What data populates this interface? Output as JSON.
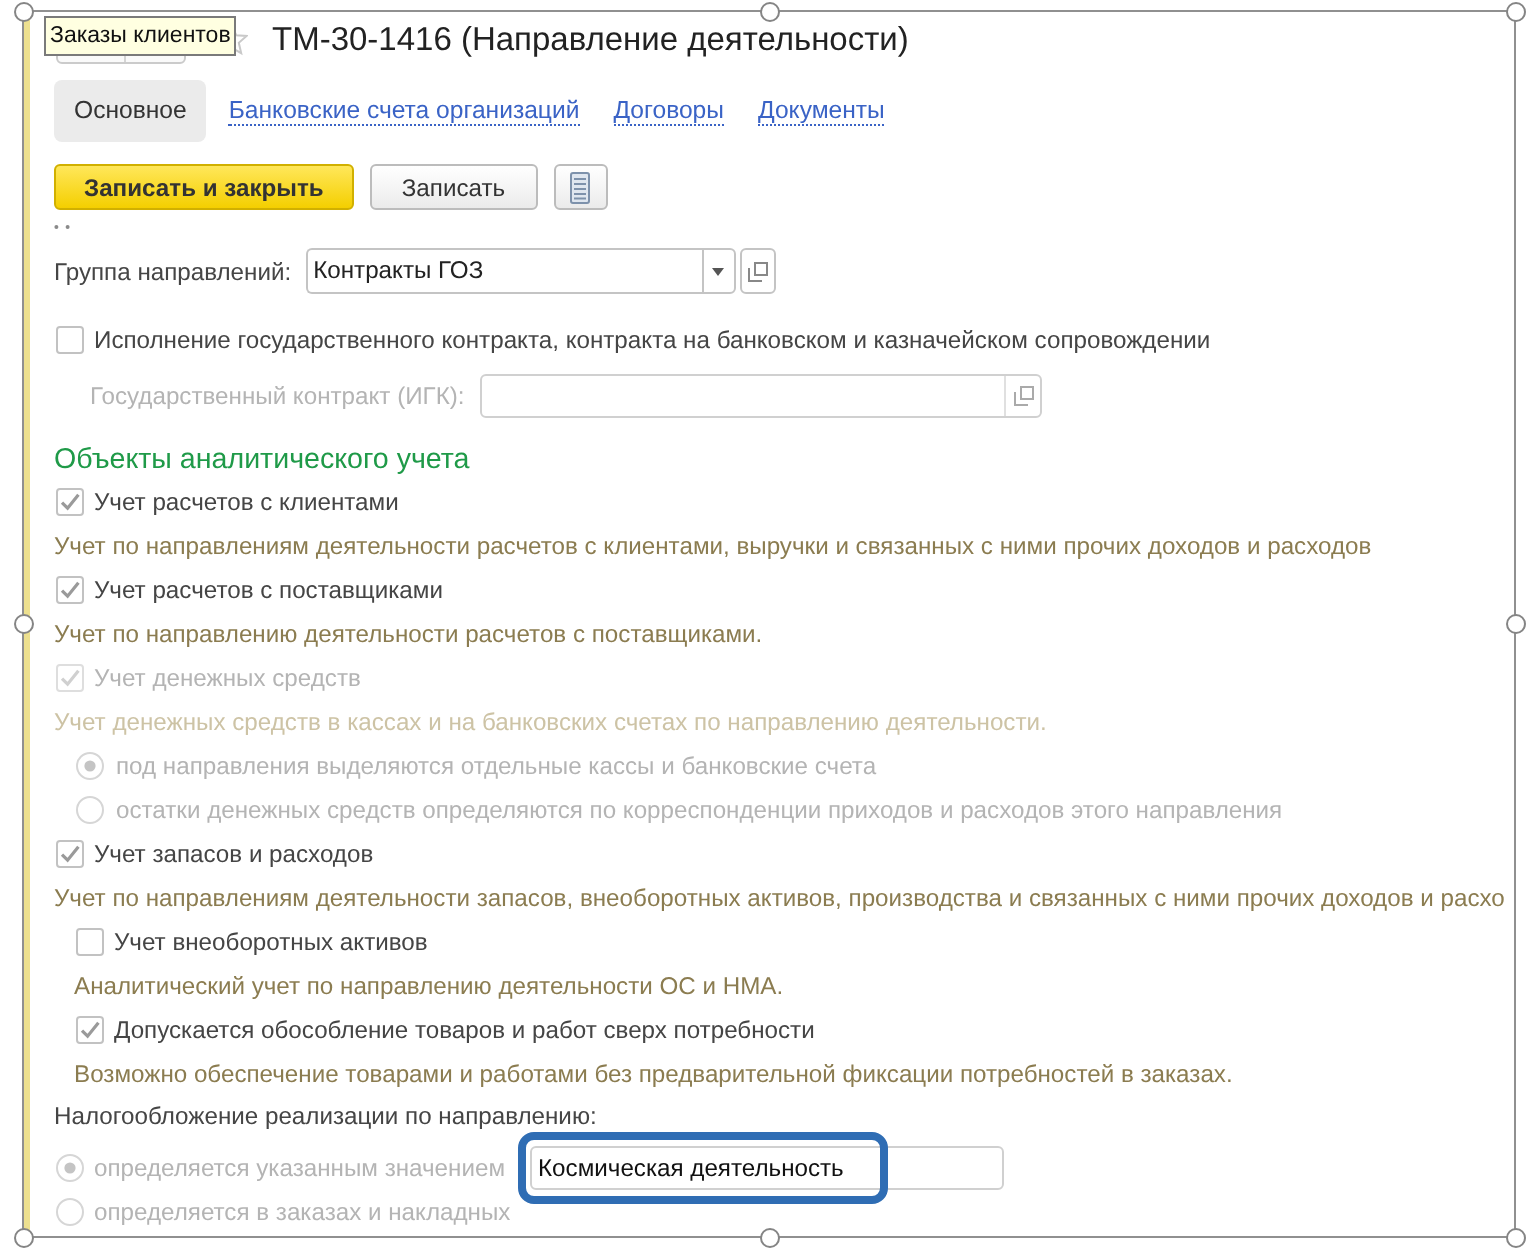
{
  "tooltip": {
    "text": "Заказы клиентов"
  },
  "window": {
    "title": "ТМ-30-1416 (Направление деятельности)"
  },
  "tabs": [
    {
      "label": "Основное",
      "selected": true
    },
    {
      "label": "Банковские счета организаций",
      "selected": false
    },
    {
      "label": "Договоры",
      "selected": false
    },
    {
      "label": "Документы",
      "selected": false
    }
  ],
  "toolbar": {
    "buttons": [
      {
        "kind": "primary",
        "label": "Записать и закрыть"
      },
      {
        "kind": "default",
        "label": "Записать"
      },
      {
        "kind": "icon"
      }
    ]
  },
  "group": {
    "label": "Группа направлений:",
    "value": "Контракты ГОЗ"
  },
  "state_contract": {
    "label": "Исполнение государственного контракта, контракта на банковском и казначейском сопровождении",
    "checked": false,
    "igk": {
      "label": "Государственный контракт (ИГК):",
      "disabled": true
    }
  },
  "analytics": {
    "title": "Объекты аналитического учета",
    "items": [
      {
        "kind": "checkbox",
        "label": "Учет расчетов с клиентами",
        "checked": true,
        "disabled": false,
        "description": "Учет по направлениям деятельности расчетов с клиентами, выручки и связанных с ними прочих доходов и расходов"
      },
      {
        "kind": "checkbox",
        "label": "Учет расчетов с поставщиками",
        "checked": true,
        "disabled": false,
        "description": "Учет по направлению деятельности расчетов с поставщиками."
      },
      {
        "kind": "checkbox",
        "label": "Учет денежных средств",
        "checked": true,
        "disabled": true,
        "description": "Учет денежных средств в кассах и на банковских счетах по направлению деятельности.",
        "children": [
          {
            "kind": "radio",
            "label": "под направления выделяются отдельные кассы и банковские счета",
            "selected": true,
            "disabled": true
          },
          {
            "kind": "radio",
            "label": "остатки денежных средств определяются по корреспонденции приходов и расходов этого направления",
            "selected": false,
            "disabled": true
          }
        ]
      },
      {
        "kind": "checkbox",
        "label": "Учет запасов и расходов",
        "checked": true,
        "disabled": false,
        "description": "Учет по направлениям деятельности запасов, внеоборотных активов, производства и связанных с ними прочих доходов и расхо",
        "children": [
          {
            "kind": "checkbox",
            "label": "Учет внеоборотных активов",
            "checked": false,
            "disabled": false,
            "description": "Аналитический учет по направлению деятельности ОС и НМА."
          },
          {
            "kind": "checkbox",
            "label": "Допускается обособление товаров и работ сверх потребности",
            "checked": true,
            "disabled": false,
            "description": "Возможно обеспечение товарами и работами без предварительной фиксации потребностей в заказах."
          }
        ]
      }
    ]
  },
  "taxation": {
    "label": "Налогообложение реализации по направлению:",
    "options": [
      {
        "label": "определяется указанным значением",
        "selected": true,
        "disabled": true,
        "field": {
          "value": "Космическая деятельность",
          "highlighted": true
        }
      },
      {
        "label": "определяется в заказах и накладных",
        "selected": false,
        "disabled": true
      }
    ]
  }
}
